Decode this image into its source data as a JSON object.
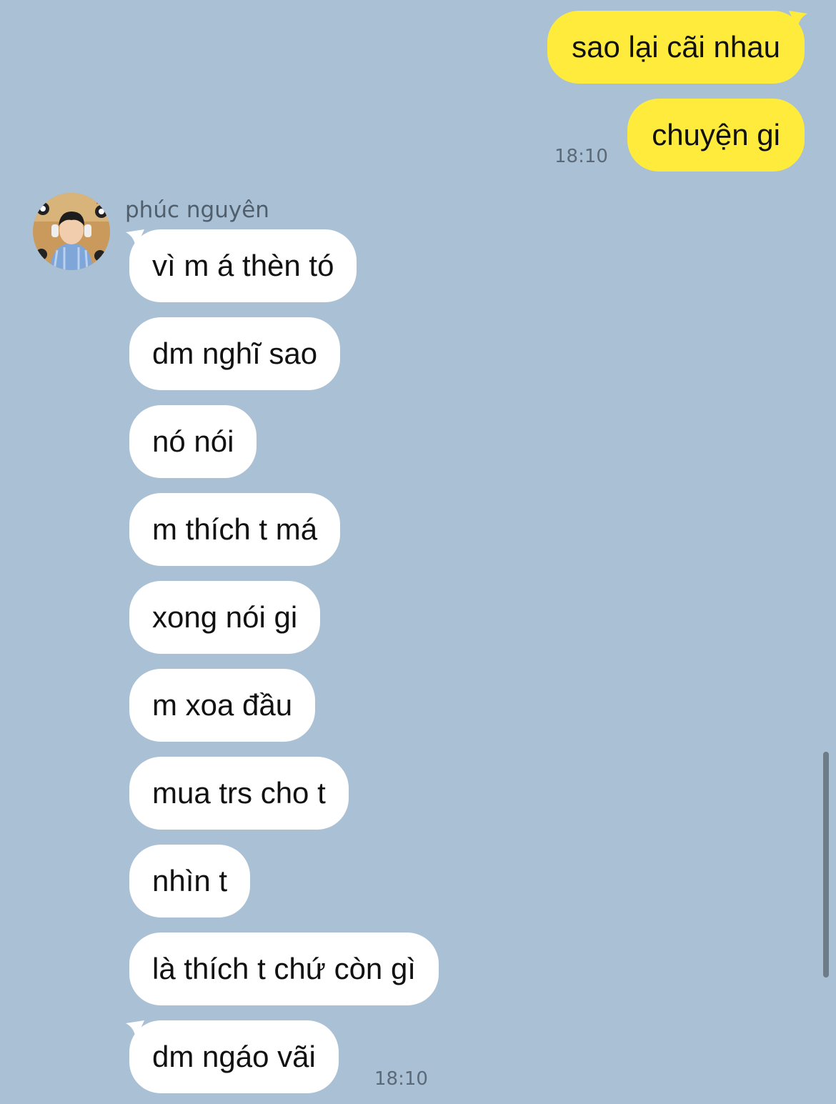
{
  "outgoing": [
    {
      "text": "sao lại cãi nhau"
    },
    {
      "text": "chuyện gi",
      "time": "18:10"
    }
  ],
  "contact": {
    "name": "phúc nguyên",
    "avatar_icon": "contact-photo-avatar"
  },
  "incoming": [
    {
      "text": "vì m á thèn tó"
    },
    {
      "text": "dm nghĩ sao"
    },
    {
      "text": "nó nói"
    },
    {
      "text": "m thích t má"
    },
    {
      "text": "xong nói gi"
    },
    {
      "text": "m xoa đầu"
    },
    {
      "text": "mua trs cho t"
    },
    {
      "text": "nhìn t"
    },
    {
      "text": "là thích t chứ còn gì"
    },
    {
      "text": "dm ngáo vãi",
      "time": "18:10"
    }
  ],
  "colors": {
    "background": "#aac0d4",
    "outgoing_bubble": "#ffeb3b",
    "incoming_bubble": "#ffffff"
  }
}
